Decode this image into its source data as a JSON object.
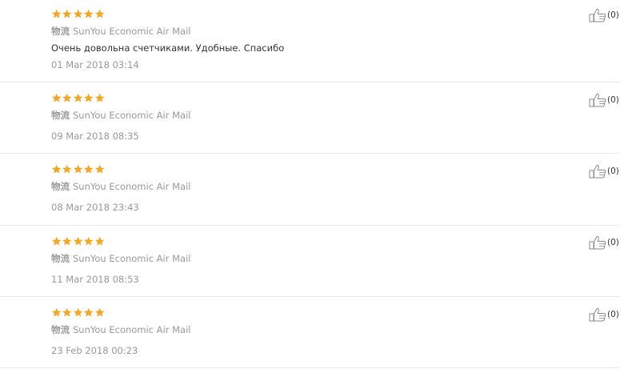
{
  "reviews": [
    {
      "rating": 5,
      "shipping_label": "物流",
      "shipping_method": "SunYou Economic Air Mail",
      "text": "Очень довольна счетчиками. Удобные. Спасибо",
      "date": "01 Mar 2018 03:14",
      "helpful_count": "(0)"
    },
    {
      "rating": 5,
      "shipping_label": "物流",
      "shipping_method": "SunYou Economic Air Mail",
      "text": "",
      "date": "09 Mar 2018 08:35",
      "helpful_count": "(0)"
    },
    {
      "rating": 5,
      "shipping_label": "物流",
      "shipping_method": "SunYou Economic Air Mail",
      "text": "",
      "date": "08 Mar 2018 23:43",
      "helpful_count": "(0)"
    },
    {
      "rating": 5,
      "shipping_label": "物流",
      "shipping_method": "SunYou Economic Air Mail",
      "text": "",
      "date": "11 Mar 2018 08:53",
      "helpful_count": "(0)"
    },
    {
      "rating": 5,
      "shipping_label": "物流",
      "shipping_method": "SunYou Economic Air Mail",
      "text": "",
      "date": "23 Feb 2018 00:23",
      "helpful_count": "(0)"
    }
  ],
  "colors": {
    "star": "#f5a623",
    "separator": "#e9e9e9",
    "muted_text": "#999999"
  },
  "icons": {
    "star": "star-icon",
    "helpful": "thumbs-up-icon"
  }
}
